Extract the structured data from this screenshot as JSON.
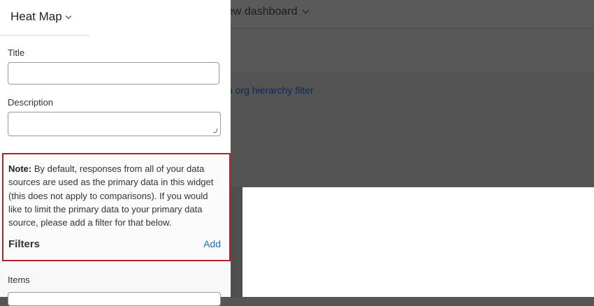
{
  "background": {
    "dashboard_title": "ew dashboard",
    "filter_link": "n org hierarchy filter"
  },
  "panel": {
    "widget_type": "Heat Map",
    "title_label": "Title",
    "title_value": "",
    "description_label": "Description",
    "description_value": "",
    "note_prefix": "Note:",
    "note_body": " By default, responses from all of your data sources are used as the primary data in this widget (this does not apply to comparisons). If you would like to limit the primary data to your primary data source, please add a filter for that below.",
    "filters_label": "Filters",
    "add_label": "Add",
    "items_label": "Items"
  },
  "colors": {
    "accent_link": "#1a6fc0",
    "highlight_border": "#b41f2e",
    "overlay": "#545454"
  }
}
